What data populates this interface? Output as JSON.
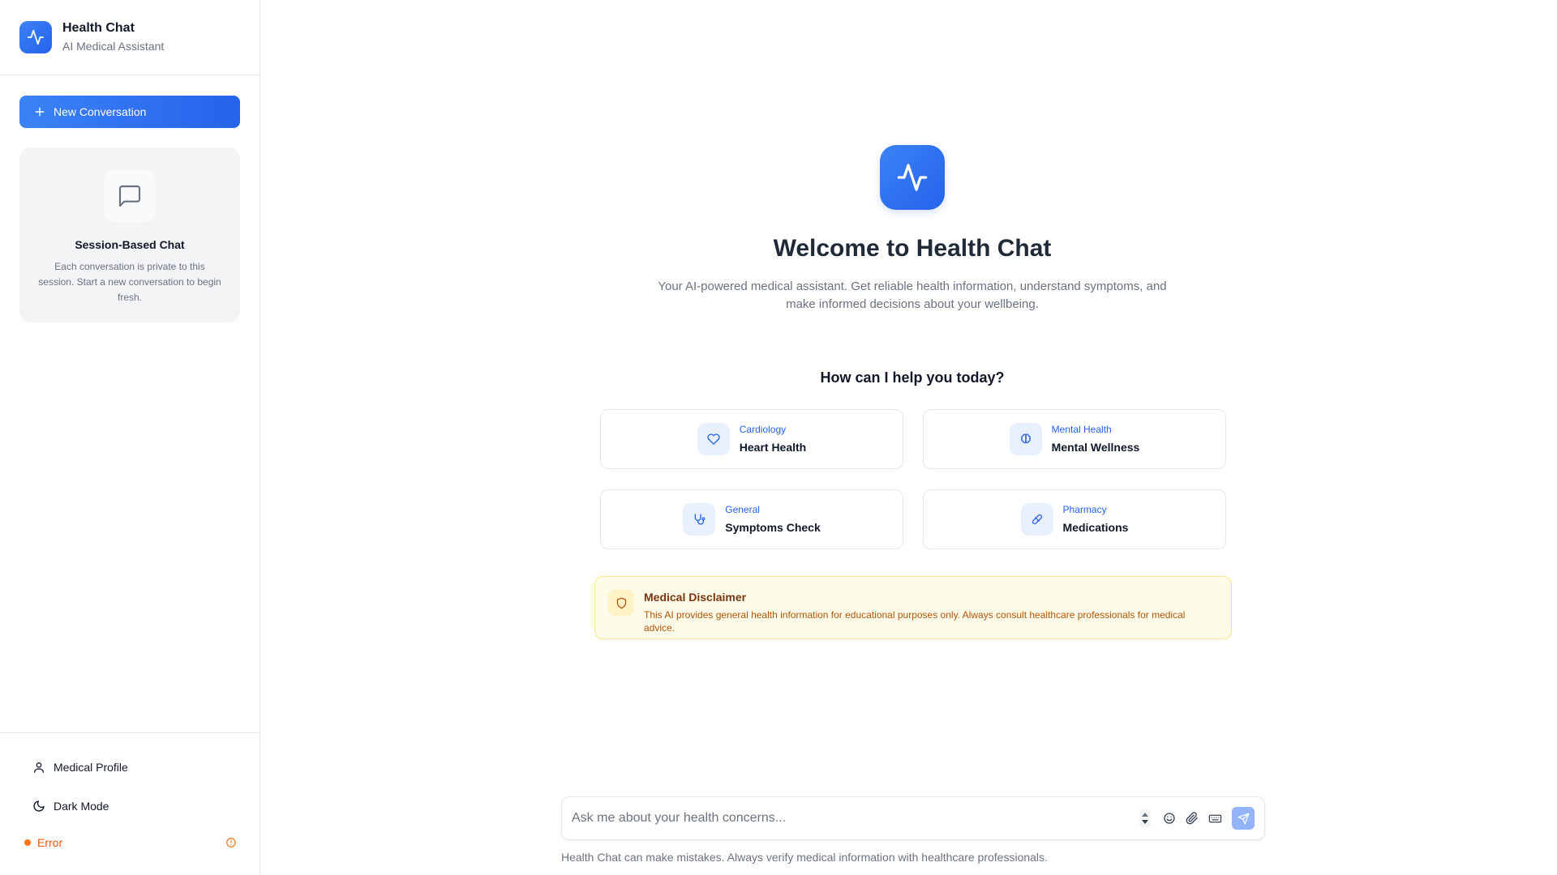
{
  "brand": {
    "title": "Health Chat",
    "subtitle": "AI Medical Assistant",
    "icon": "activity-pulse-icon",
    "accent_color": "#2563eb"
  },
  "sidebar": {
    "new_conversation_label": "New Conversation",
    "session_card": {
      "title": "Session-Based Chat",
      "description": "Each conversation is private to this session. Start a new conversation to begin fresh."
    },
    "footer": {
      "medical_profile_label": "Medical Profile",
      "dark_mode_label": "Dark Mode",
      "status_label": "Error",
      "status_color": "#ea580c"
    }
  },
  "main": {
    "welcome_title": "Welcome to Health Chat",
    "welcome_subtitle": "Your AI-powered medical assistant. Get reliable health information, understand symptoms, and make informed decisions about your wellbeing.",
    "help_heading": "How can I help you today?",
    "topics": [
      {
        "category": "Cardiology",
        "title": "Heart Health",
        "icon": "heart-icon"
      },
      {
        "category": "Mental Health",
        "title": "Mental Wellness",
        "icon": "brain-icon"
      },
      {
        "category": "General",
        "title": "Symptoms Check",
        "icon": "stethoscope-icon"
      },
      {
        "category": "Pharmacy",
        "title": "Medications",
        "icon": "pill-icon"
      }
    ],
    "disclaimer": {
      "title": "Medical Disclaimer",
      "text": "This AI provides general health information for educational purposes only. Always consult healthcare professionals for medical advice.",
      "icon": "shield-icon"
    },
    "input": {
      "placeholder": "Ask me about your health concerns...",
      "value": ""
    },
    "footnote": "Health Chat can make mistakes. Always verify medical information with healthcare professionals."
  }
}
